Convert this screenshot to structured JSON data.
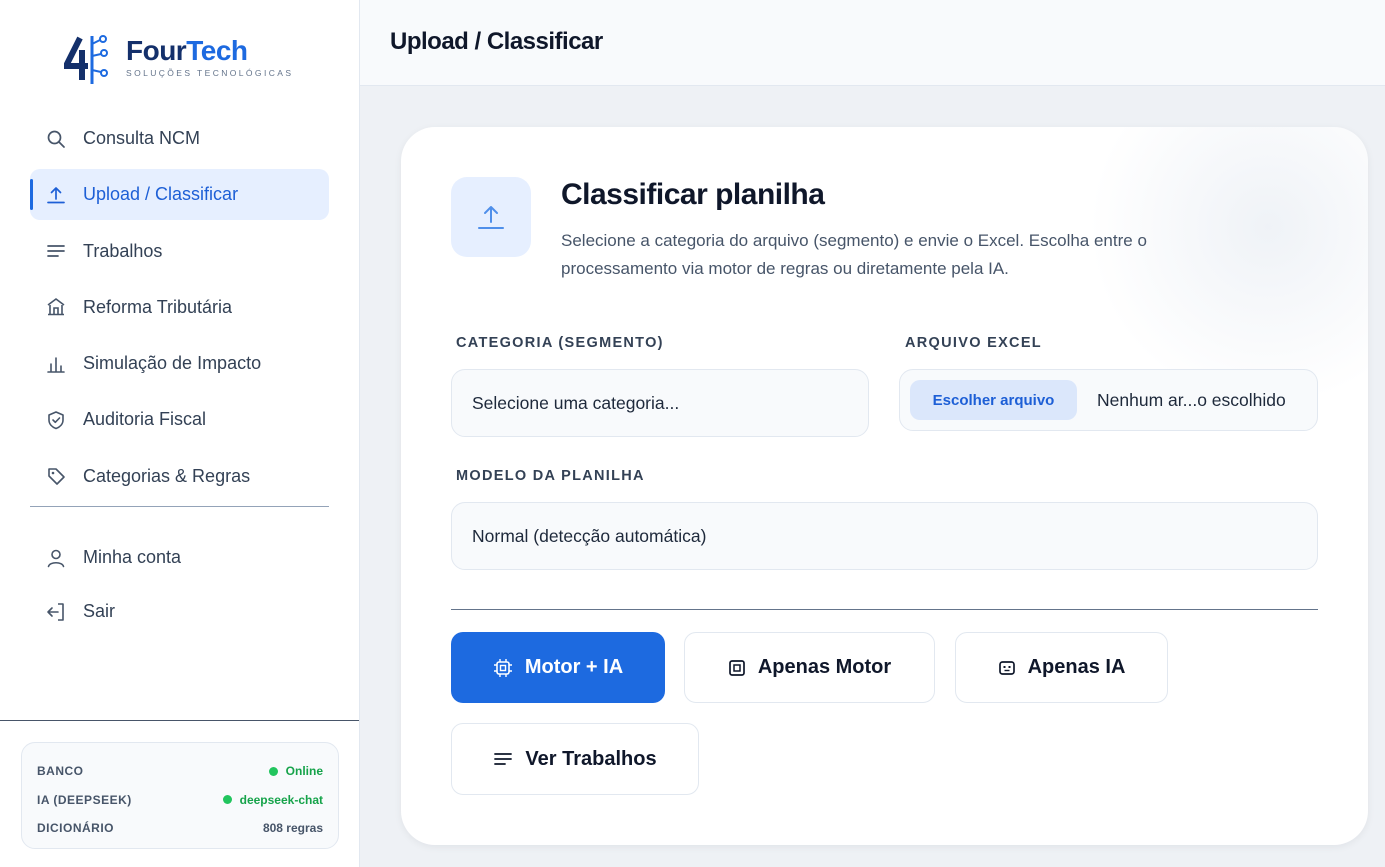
{
  "brand": {
    "name_part1": "Four",
    "name_part2": "Tech",
    "tagline": "SOLUÇÕES TECNOLÓGICAS"
  },
  "sidebar": {
    "items": [
      {
        "label": "Consulta NCM",
        "icon": "search-icon"
      },
      {
        "label": "Upload / Classificar",
        "icon": "upload-icon",
        "active": true
      },
      {
        "label": "Trabalhos",
        "icon": "list-icon"
      },
      {
        "label": "Reforma Tributária",
        "icon": "building-icon"
      },
      {
        "label": "Simulação de Impacto",
        "icon": "bar-chart-icon"
      },
      {
        "label": "Auditoria Fiscal",
        "icon": "shield-icon"
      },
      {
        "label": "Categorias & Regras",
        "icon": "tag-icon"
      }
    ],
    "account_items": [
      {
        "label": "Minha conta",
        "icon": "user-icon"
      },
      {
        "label": "Sair",
        "icon": "logout-icon"
      }
    ],
    "status": [
      {
        "label": "BANCO",
        "value": "Online",
        "indicator": "green"
      },
      {
        "label": "IA (DEEPSEEK)",
        "value": "deepseek-chat",
        "indicator": "green"
      },
      {
        "label": "DICIONÁRIO",
        "value": "808 regras"
      }
    ]
  },
  "header": {
    "title": "Upload / Classificar"
  },
  "card": {
    "title": "Classificar planilha",
    "description": "Selecione a categoria do arquivo (segmento) e envie o Excel. Escolha entre o processamento via motor de regras ou diretamente pela IA.",
    "category_label": "CATEGORIA (SEGMENTO)",
    "category_value": "Selecione uma categoria...",
    "file_label": "ARQUIVO EXCEL",
    "file_button": "Escolher arquivo",
    "file_name": "Nenhum ar...o escolhido",
    "model_label": "MODELO DA PLANILHA",
    "model_value": "Normal (detecção automática)",
    "buttons": {
      "motor_ia": "Motor + IA",
      "apenas_motor": "Apenas Motor",
      "apenas_ia": "Apenas IA",
      "ver_trabalhos": "Ver Trabalhos"
    }
  },
  "colors": {
    "accent": "#1d6ae0",
    "brand_dark": "#14306b",
    "active_bg": "#e6efff",
    "online": "#22c55e"
  }
}
